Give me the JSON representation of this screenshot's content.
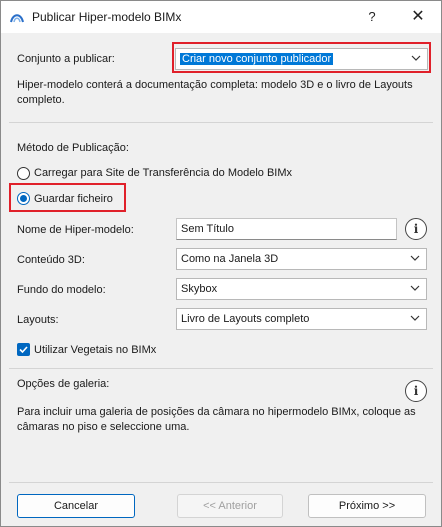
{
  "window": {
    "title": "Publicar Hiper-modelo BIMx",
    "help_label": "?",
    "close_label": "✕"
  },
  "set": {
    "label": "Conjunto a publicar:",
    "value": "Criar novo conjunto publicador",
    "description": "Hiper-modelo conterá a documentação completa: modelo 3D e o livro de Layouts completo."
  },
  "method": {
    "title": "Método de Publicação:",
    "options": [
      {
        "label": "Carregar para Site de Transferência do Modelo BIMx",
        "checked": false
      },
      {
        "label": "Guardar ficheiro",
        "checked": true
      }
    ]
  },
  "fields": {
    "name_label": "Nome de Hiper-modelo:",
    "name_value": "Sem Título",
    "content3d_label": "Conteúdo 3D:",
    "content3d_value": "Como na Janela 3D",
    "background_label": "Fundo do modelo:",
    "background_value": "Skybox",
    "layouts_label": "Layouts:",
    "layouts_value": "Livro de Layouts completo",
    "vegetation_label": "Utilizar Vegetais no BIMx",
    "vegetation_checked": true
  },
  "gallery": {
    "title": "Opções de galeria:",
    "description": "Para incluir uma galeria de posições da câmara no hipermodelo BIMx, coloque as câmaras no piso e seleccione uma."
  },
  "footer": {
    "cancel": "Cancelar",
    "previous": "<< Anterior",
    "next": "Próximo >>"
  },
  "colors": {
    "accent": "#0067c0",
    "highlight_box": "#e0202a",
    "selection": "#0078d7"
  }
}
